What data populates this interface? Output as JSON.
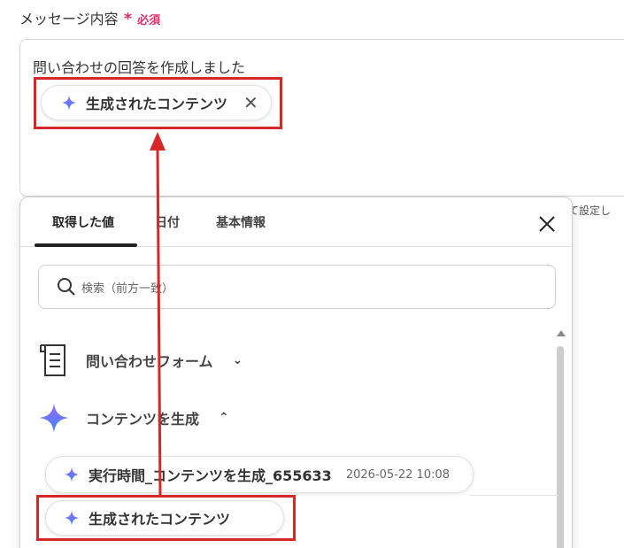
{
  "field": {
    "label": "メッセージ内容",
    "required_star": "*",
    "required_text": "必須",
    "message_text": "問い合わせの回答を作成しました",
    "chip_label": "生成されたコンテンツ",
    "hint_text": "て設定し"
  },
  "popup": {
    "tabs": [
      {
        "label": "取得した値"
      },
      {
        "label": "日付"
      },
      {
        "label": "基本情報"
      }
    ],
    "search_placeholder": "検索（前方一致）",
    "sections": [
      {
        "label": "問い合わせフォーム",
        "chevron": "down",
        "icon": "form-document-icon"
      },
      {
        "label": "コンテンツを生成",
        "chevron": "up",
        "icon": "ai-sparkle-icon"
      }
    ],
    "items": [
      {
        "label": "実行時間_コンテンツを生成_655633",
        "sub": "2026-05-22 10:08"
      },
      {
        "label": "生成されたコンテンツ",
        "sub": ""
      }
    ]
  },
  "colors": {
    "required": "#e0306a",
    "highlight": "#d62828",
    "arrow": "#d62828",
    "sparkle_top": "#9b6bff",
    "sparkle_bottom": "#3b82f6"
  }
}
